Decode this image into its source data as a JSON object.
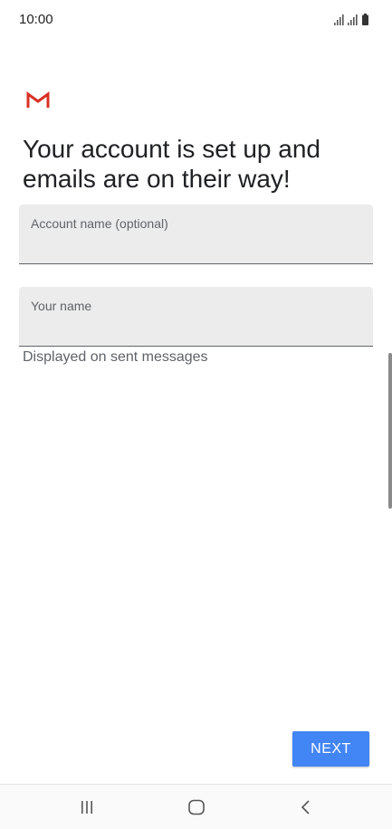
{
  "status_bar": {
    "time": "10:00",
    "icons": [
      "signal-icon",
      "signal-icon",
      "battery-icon"
    ]
  },
  "app": {
    "logo_icon": "gmail-logo-icon",
    "logo_color": "#d93025"
  },
  "main": {
    "headline": "Your account is set up and emails are on their way!",
    "fields": [
      {
        "label": "Account name (optional)",
        "value": ""
      },
      {
        "label": "Your name",
        "value": ""
      }
    ],
    "helper_text": "Displayed on sent messages",
    "next_label": "NEXT",
    "accent_color": "#4285f4"
  },
  "nav_bar": {
    "buttons": [
      "recent-apps-icon",
      "home-icon",
      "back-icon"
    ]
  }
}
